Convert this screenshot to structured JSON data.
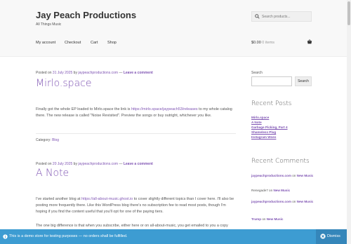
{
  "site": {
    "title": "Jay Peach Productions",
    "tagline": "All Things Music"
  },
  "search": {
    "placeholder": "Search products..."
  },
  "nav": {
    "items": [
      "My account",
      "Checkout",
      "Cart",
      "Shop"
    ]
  },
  "cart": {
    "total": "$0.00",
    "items": "0 items"
  },
  "posts": [
    {
      "posted_on": "Posted on",
      "date": "31 July 2025",
      "by": "by",
      "author": "jaypeachproductions.com",
      "sep": "—",
      "leave": "Leave a comment",
      "title": "Mirlo.space",
      "body_pre": "Finally got the whole EP loaded to Mirlo.space the link is ",
      "body_link": "https://mirlo.space/jaypeach53/releases",
      "body_post": " to my whole catalog there. The new release is called \"Noise Revisited\". Preview the songs or buy outright, whichever you like.",
      "category_label": "Category",
      "category": "Blog"
    },
    {
      "posted_on": "Posted on",
      "date": "20 July 2025",
      "by": "by",
      "author": "jaypeachproductions.com",
      "sep": "—",
      "leave": "Leave a comment",
      "title": "A Note",
      "body_pre": "I've started another blog at ",
      "body_link": "https://all-about-music.ghost.io",
      "body_post": " to cover slightly different topics than I cover here. I'll also be posting more frequently there. Like this WordPress blog there's no subscription fee to read most posts, though I'm hoping if you find the content useful that you'll opt for one of the paying tiers.",
      "body2": "The one big difference is that when you subscribe, either here or on all-about-music, you get emailed to you a copy"
    }
  ],
  "sidebar": {
    "search_label": "Search",
    "search_button": "Search",
    "recent_posts_title": "Recent Posts",
    "recent_posts": [
      "Mirlo.space",
      "A Note",
      "Garbage Picking, Part 4",
      "Shameless Plug",
      "Instagram Woes"
    ],
    "recent_comments_title": "Recent Comments",
    "comments": [
      {
        "author": "jaypeachproductions.com",
        "on": "on",
        "post": "New Music"
      },
      {
        "author": "Renegade7",
        "on": "on",
        "post": "New Music"
      },
      {
        "author": "jaypeachproductions.com",
        "on": "on",
        "post": "New Music"
      },
      {
        "author": "Trump",
        "on": "on",
        "post": "New Music"
      }
    ]
  },
  "notice": {
    "message": "This is a demo store for testing purposes — no orders shall be fulfilled.",
    "dismiss": "Dismiss"
  }
}
